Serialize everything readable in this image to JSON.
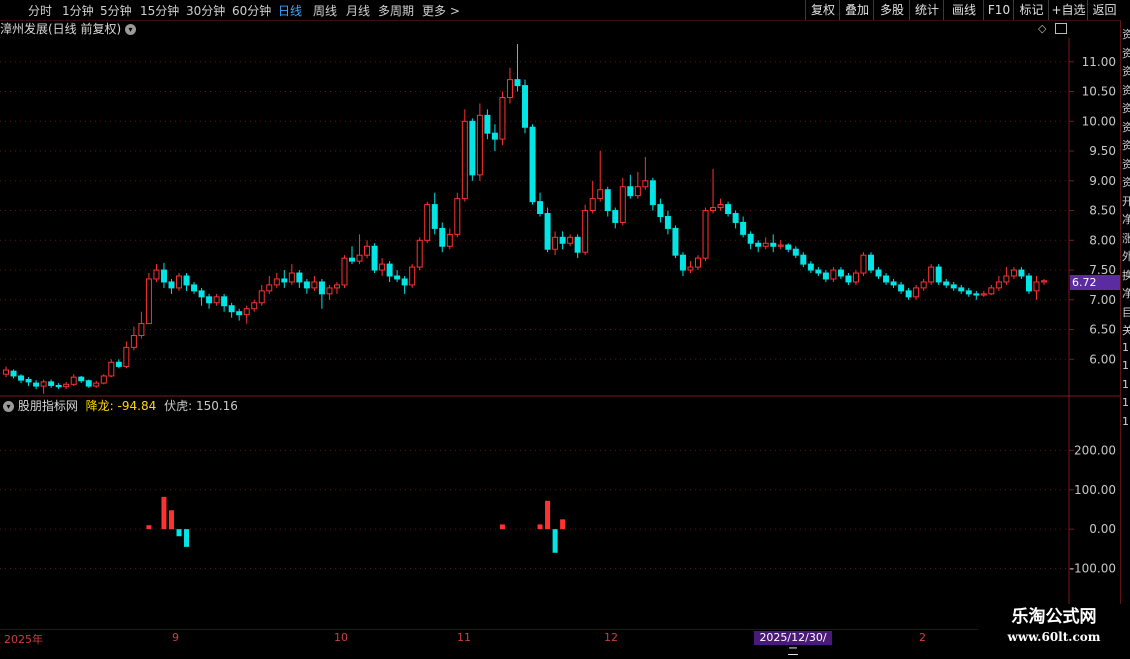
{
  "toolbar": {
    "periods": [
      "分时",
      "1分钟",
      "5分钟",
      "15分钟",
      "30分钟",
      "60分钟",
      "日线",
      "周线",
      "月线",
      "多周期",
      "更多 >"
    ],
    "active": "日线",
    "right_buttons": [
      "复权",
      "叠加",
      "多股",
      "统计",
      "画线",
      "F10",
      "标记",
      "+自选",
      "返回"
    ]
  },
  "main": {
    "title": "漳州发展(日线 前复权)",
    "last_price": "6.72",
    "price_axis": [
      "11.00",
      "10.50",
      "10.00",
      "9.50",
      "9.00",
      "8.50",
      "8.00",
      "7.50",
      "7.00",
      "6.50",
      "6.00"
    ]
  },
  "indicator": {
    "name": "股朋指标网",
    "label1": "降龙:",
    "value1": "-94.84",
    "label2": "伏虎:",
    "value2": "150.16",
    "axis": [
      "200.00",
      "100.00",
      "0.00",
      "-100.00"
    ]
  },
  "date_axis": {
    "labels": [
      "2025年",
      "9",
      "10",
      "11",
      "12",
      "2"
    ],
    "highlight": "2025/12/30/二"
  },
  "right_strip": [
    "资",
    "资",
    "资",
    "资",
    "资",
    "资",
    "资",
    "资",
    "资",
    "开",
    "净",
    "涨",
    "外",
    "换",
    "净",
    "目",
    "关",
    "1",
    "1",
    "1",
    "1",
    "1"
  ],
  "watermark": {
    "line1": "乐淘公式网",
    "line2": "www.60lt.com"
  },
  "colors": {
    "up": "#ff3232",
    "down": "#00e5e5",
    "grid": "#5a1616",
    "axis_text": "#c8c8c8"
  },
  "chart_data": [
    {
      "type": "candlestick",
      "title": "漳州发展(日线 前复权)",
      "ylim": [
        5.4,
        11.4
      ],
      "y_ticks": [
        11.0,
        10.5,
        10.0,
        9.5,
        9.0,
        8.5,
        8.0,
        7.5,
        7.0,
        6.5,
        6.0
      ],
      "last_price": 6.72,
      "candles": [
        [
          5.75,
          5.82,
          5.88,
          5.7
        ],
        [
          5.8,
          5.72,
          5.83,
          5.68
        ],
        [
          5.72,
          5.65,
          5.75,
          5.6
        ],
        [
          5.66,
          5.62,
          5.7,
          5.55
        ],
        [
          5.6,
          5.55,
          5.65,
          5.5
        ],
        [
          5.55,
          5.62,
          5.66,
          5.42
        ],
        [
          5.62,
          5.56,
          5.66,
          5.52
        ],
        [
          5.56,
          5.54,
          5.6,
          5.5
        ],
        [
          5.54,
          5.58,
          5.62,
          5.5
        ],
        [
          5.58,
          5.7,
          5.75,
          5.55
        ],
        [
          5.7,
          5.64,
          5.72,
          5.6
        ],
        [
          5.64,
          5.55,
          5.66,
          5.52
        ],
        [
          5.55,
          5.6,
          5.64,
          5.52
        ],
        [
          5.6,
          5.72,
          5.75,
          5.58
        ],
        [
          5.72,
          5.95,
          6.0,
          5.7
        ],
        [
          5.95,
          5.88,
          6.0,
          5.85
        ],
        [
          5.88,
          6.2,
          6.3,
          5.85
        ],
        [
          6.2,
          6.4,
          6.55,
          6.15
        ],
        [
          6.4,
          6.6,
          6.8,
          6.35
        ],
        [
          6.6,
          7.35,
          7.45,
          6.6
        ],
        [
          7.35,
          7.5,
          7.6,
          7.3
        ],
        [
          7.5,
          7.3,
          7.62,
          7.2
        ],
        [
          7.3,
          7.2,
          7.35,
          7.1
        ],
        [
          7.2,
          7.4,
          7.45,
          7.15
        ],
        [
          7.4,
          7.25,
          7.45,
          7.15
        ],
        [
          7.25,
          7.15,
          7.3,
          7.1
        ],
        [
          7.15,
          7.05,
          7.2,
          6.9
        ],
        [
          7.05,
          6.95,
          7.1,
          6.85
        ],
        [
          6.95,
          7.05,
          7.1,
          6.9
        ],
        [
          7.05,
          6.9,
          7.1,
          6.8
        ],
        [
          6.9,
          6.8,
          6.95,
          6.7
        ],
        [
          6.8,
          6.75,
          6.85,
          6.65
        ],
        [
          6.75,
          6.85,
          6.9,
          6.6
        ],
        [
          6.85,
          6.95,
          7.0,
          6.8
        ],
        [
          6.95,
          7.15,
          7.25,
          6.9
        ],
        [
          7.15,
          7.25,
          7.4,
          7.1
        ],
        [
          7.25,
          7.35,
          7.45,
          7.2
        ],
        [
          7.35,
          7.3,
          7.5,
          7.2
        ],
        [
          7.3,
          7.45,
          7.6,
          7.25
        ],
        [
          7.45,
          7.3,
          7.5,
          7.2
        ],
        [
          7.3,
          7.2,
          7.35,
          7.1
        ],
        [
          7.2,
          7.3,
          7.4,
          7.15
        ],
        [
          7.3,
          7.1,
          7.35,
          6.85
        ],
        [
          7.1,
          7.2,
          7.25,
          7.0
        ],
        [
          7.2,
          7.25,
          7.3,
          7.1
        ],
        [
          7.25,
          7.7,
          7.75,
          7.2
        ],
        [
          7.7,
          7.65,
          7.9,
          7.6
        ],
        [
          7.65,
          7.75,
          8.1,
          7.6
        ],
        [
          7.75,
          7.9,
          8.0,
          7.7
        ],
        [
          7.9,
          7.5,
          7.95,
          7.45
        ],
        [
          7.5,
          7.6,
          7.7,
          7.4
        ],
        [
          7.6,
          7.4,
          7.65,
          7.3
        ],
        [
          7.4,
          7.35,
          7.5,
          7.3
        ],
        [
          7.35,
          7.25,
          7.4,
          7.1
        ],
        [
          7.25,
          7.55,
          7.6,
          7.2
        ],
        [
          7.55,
          8.0,
          8.05,
          7.5
        ],
        [
          8.0,
          8.6,
          8.65,
          7.95
        ],
        [
          8.6,
          8.2,
          8.8,
          8.1
        ],
        [
          8.2,
          7.9,
          8.3,
          7.8
        ],
        [
          7.9,
          8.1,
          8.2,
          7.85
        ],
        [
          8.1,
          8.7,
          8.8,
          8.05
        ],
        [
          8.7,
          10.0,
          10.2,
          8.65
        ],
        [
          10.0,
          9.1,
          10.05,
          9.0
        ],
        [
          9.1,
          10.1,
          10.3,
          9.0
        ],
        [
          10.1,
          9.8,
          10.2,
          9.7
        ],
        [
          9.8,
          9.7,
          9.95,
          9.5
        ],
        [
          9.7,
          10.4,
          10.5,
          9.6
        ],
        [
          10.4,
          10.7,
          10.9,
          10.3
        ],
        [
          10.7,
          10.6,
          11.3,
          10.5
        ],
        [
          10.6,
          9.9,
          10.7,
          9.8
        ],
        [
          9.9,
          8.65,
          9.95,
          8.6
        ],
        [
          8.65,
          8.45,
          8.8,
          8.4
        ],
        [
          8.45,
          7.85,
          8.55,
          7.8
        ],
        [
          7.85,
          8.05,
          8.15,
          7.75
        ],
        [
          8.05,
          7.95,
          8.15,
          7.85
        ],
        [
          7.95,
          8.05,
          8.1,
          7.9
        ],
        [
          8.05,
          7.8,
          8.1,
          7.7
        ],
        [
          7.8,
          8.5,
          8.6,
          7.75
        ],
        [
          8.5,
          8.7,
          9.0,
          8.45
        ],
        [
          8.7,
          8.85,
          9.5,
          8.65
        ],
        [
          8.85,
          8.5,
          8.9,
          8.4
        ],
        [
          8.5,
          8.3,
          8.55,
          8.2
        ],
        [
          8.3,
          8.9,
          9.05,
          8.25
        ],
        [
          8.9,
          8.75,
          9.1,
          8.7
        ],
        [
          8.75,
          8.9,
          9.15,
          8.7
        ],
        [
          8.9,
          9.0,
          9.4,
          8.85
        ],
        [
          9.0,
          8.6,
          9.05,
          8.5
        ],
        [
          8.6,
          8.4,
          8.7,
          8.3
        ],
        [
          8.4,
          8.2,
          8.5,
          8.1
        ],
        [
          8.2,
          7.75,
          8.25,
          7.7
        ],
        [
          7.75,
          7.5,
          7.8,
          7.4
        ],
        [
          7.5,
          7.55,
          7.65,
          7.45
        ],
        [
          7.55,
          7.7,
          7.75,
          7.5
        ],
        [
          7.7,
          8.5,
          8.55,
          7.65
        ],
        [
          8.5,
          8.55,
          9.2,
          8.45
        ],
        [
          8.55,
          8.6,
          8.7,
          8.5
        ],
        [
          8.6,
          8.45,
          8.65,
          8.4
        ],
        [
          8.45,
          8.3,
          8.5,
          8.2
        ],
        [
          8.3,
          8.1,
          8.4,
          8.05
        ],
        [
          8.1,
          7.95,
          8.15,
          7.85
        ],
        [
          7.95,
          7.9,
          8.0,
          7.8
        ],
        [
          7.9,
          7.95,
          8.05,
          7.85
        ],
        [
          7.95,
          7.9,
          8.1,
          7.8
        ],
        [
          7.9,
          7.92,
          8.0,
          7.85
        ],
        [
          7.92,
          7.85,
          7.95,
          7.8
        ],
        [
          7.85,
          7.75,
          7.9,
          7.7
        ],
        [
          7.75,
          7.6,
          7.8,
          7.55
        ],
        [
          7.6,
          7.5,
          7.65,
          7.45
        ],
        [
          7.5,
          7.45,
          7.55,
          7.4
        ],
        [
          7.45,
          7.35,
          7.5,
          7.3
        ],
        [
          7.35,
          7.5,
          7.55,
          7.3
        ],
        [
          7.5,
          7.4,
          7.55,
          7.35
        ],
        [
          7.4,
          7.3,
          7.45,
          7.25
        ],
        [
          7.3,
          7.45,
          7.5,
          7.25
        ],
        [
          7.45,
          7.75,
          7.8,
          7.4
        ],
        [
          7.75,
          7.5,
          7.8,
          7.45
        ],
        [
          7.5,
          7.4,
          7.55,
          7.35
        ],
        [
          7.4,
          7.3,
          7.45,
          7.25
        ],
        [
          7.3,
          7.25,
          7.35,
          7.2
        ],
        [
          7.25,
          7.15,
          7.3,
          7.1
        ],
        [
          7.15,
          7.05,
          7.2,
          7.0
        ],
        [
          7.05,
          7.2,
          7.25,
          7.0
        ],
        [
          7.2,
          7.3,
          7.35,
          7.15
        ],
        [
          7.3,
          7.55,
          7.6,
          7.25
        ],
        [
          7.55,
          7.3,
          7.6,
          7.25
        ],
        [
          7.3,
          7.25,
          7.35,
          7.2
        ],
        [
          7.25,
          7.2,
          7.3,
          7.15
        ],
        [
          7.2,
          7.15,
          7.25,
          7.1
        ],
        [
          7.15,
          7.1,
          7.2,
          7.05
        ],
        [
          7.1,
          7.08,
          7.15,
          7.0
        ],
        [
          7.08,
          7.1,
          7.15,
          7.05
        ],
        [
          7.1,
          7.2,
          7.25,
          7.08
        ],
        [
          7.2,
          7.3,
          7.4,
          7.15
        ],
        [
          7.3,
          7.4,
          7.55,
          7.25
        ],
        [
          7.4,
          7.5,
          7.55,
          7.35
        ],
        [
          7.5,
          7.4,
          7.55,
          7.35
        ],
        [
          7.4,
          7.15,
          7.45,
          7.1
        ],
        [
          7.15,
          7.3,
          7.4,
          7.0
        ],
        [
          7.3,
          7.32,
          7.35,
          7.25
        ]
      ]
    },
    {
      "type": "bar",
      "title": "股朋指标网",
      "ylim": [
        -180,
        290
      ],
      "y_ticks": [
        200,
        100,
        0,
        -100
      ],
      "bars": [
        {
          "index": 19,
          "value": 10,
          "series": "降龙"
        },
        {
          "index": 21,
          "value": 82,
          "series": "降龙"
        },
        {
          "index": 22,
          "value": 48,
          "series": "降龙"
        },
        {
          "index": 23,
          "value": -18,
          "series": "伏虎"
        },
        {
          "index": 24,
          "value": -45,
          "series": "伏虎"
        },
        {
          "index": 66,
          "value": 12,
          "series": "降龙"
        },
        {
          "index": 71,
          "value": 12,
          "series": "降龙"
        },
        {
          "index": 72,
          "value": 72,
          "series": "降龙"
        },
        {
          "index": 73,
          "value": -60,
          "series": "伏虎"
        },
        {
          "index": 74,
          "value": 25,
          "series": "降龙"
        }
      ]
    }
  ]
}
